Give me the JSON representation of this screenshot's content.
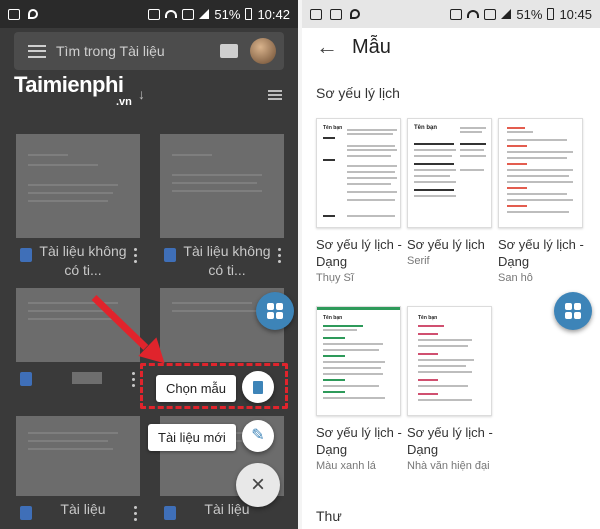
{
  "left": {
    "status": {
      "battery": "51%",
      "time": "10:42"
    },
    "search_placeholder": "Tìm trong Tài liệu",
    "logo": {
      "main": "Taimienphi",
      "sub": ".vn"
    },
    "docs": [
      {
        "title": "Tài liệu không có ti..."
      },
      {
        "title": "Tài liệu không có ti..."
      },
      {
        "title": ""
      },
      {
        "title": ""
      },
      {
        "title": "Tài liệu"
      },
      {
        "title": "Tài liệu"
      }
    ],
    "fab_menu": {
      "template_label": "Chọn mẫu",
      "new_doc_label": "Tài liệu mới",
      "close_symbol": "×"
    }
  },
  "right": {
    "status": {
      "battery": "51%",
      "time": "10:45"
    },
    "title": "Mẫu",
    "sections": [
      {
        "name": "Sơ yếu lý lịch"
      },
      {
        "name": "Thư"
      }
    ],
    "templates": [
      {
        "name": "Sơ yếu lý lịch - Dạng",
        "subtitle": "Thụy Sĩ"
      },
      {
        "name": "Sơ yếu lý lịch",
        "subtitle": "Serif"
      },
      {
        "name": "Sơ yếu lý lịch - Dạng",
        "subtitle": "San hô"
      },
      {
        "name": "Sơ yếu lý lịch - Dạng",
        "subtitle": "Màu xanh lá"
      },
      {
        "name": "Sơ yếu lý lịch - Dạng",
        "subtitle": "Nhà văn hiện đại"
      }
    ],
    "thumb_headings": [
      "Tên bạn",
      "Tên bạn",
      "Tên bạn",
      "Tên bạn"
    ]
  },
  "colors": {
    "accent_blue": "#3d84b8",
    "highlight_red": "#e0242c",
    "doc_icon_blue": "#3f6fb8"
  }
}
